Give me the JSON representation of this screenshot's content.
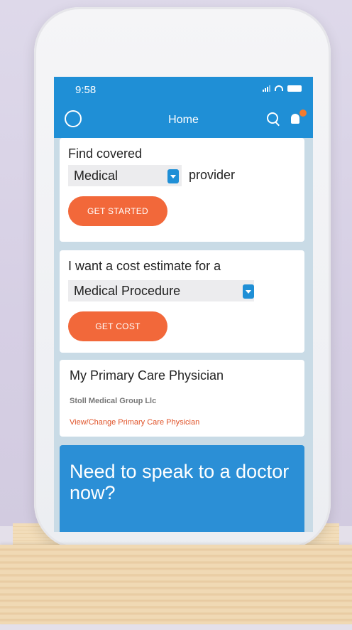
{
  "status": {
    "time": "9:58"
  },
  "nav": {
    "title": "Home"
  },
  "find_card": {
    "prefix": "Find covered",
    "select_value": "Medical",
    "suffix": "provider",
    "button": "GET STARTED"
  },
  "cost_card": {
    "prompt": "I want a cost estimate for a",
    "select_value": "Medical Procedure",
    "button": "GET COST"
  },
  "pcp_card": {
    "title": "My Primary Care Physician",
    "provider": "Stoll Medical Group Llc",
    "link": "View/Change Primary Care Physician"
  },
  "doctor_card": {
    "title": "Need to speak to a doctor now?"
  },
  "colors": {
    "brand": "#1f8fd6",
    "accent": "#f2683a",
    "link": "#e0542a"
  }
}
